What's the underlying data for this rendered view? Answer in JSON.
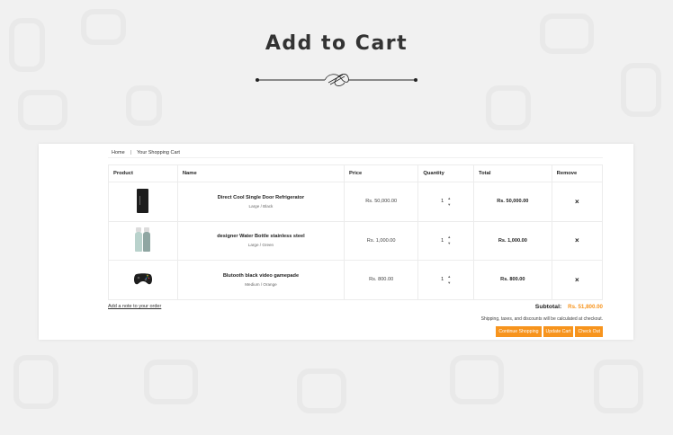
{
  "page": {
    "title": "Add to Cart"
  },
  "breadcrumb": {
    "home": "Home",
    "separator": "|",
    "current": "Your Shopping Cart"
  },
  "table": {
    "headers": [
      "Product",
      "Name",
      "Price",
      "Quantity",
      "Total",
      "Remove"
    ],
    "rows": [
      {
        "thumb_icon": "refrigerator-image",
        "name": "Direct Cool Single Door Refrigerator",
        "variant": "Large / Black",
        "price": "Rs. 50,000.00",
        "quantity": "1",
        "total": "Rs. 50,000.00",
        "remove": "×"
      },
      {
        "thumb_icon": "water-bottle-image",
        "name": "designer Water Bottle stainless steel",
        "variant": "Large / Green",
        "price": "Rs. 1,000.00",
        "quantity": "1",
        "total": "Rs. 1,000.00",
        "remove": "×"
      },
      {
        "thumb_icon": "gamepad-image",
        "name": "Blutooth black video gamepade",
        "variant": "Medium / Orange",
        "price": "Rs. 800.00",
        "quantity": "1",
        "total": "Rs. 800.00",
        "remove": "×"
      }
    ]
  },
  "footer": {
    "note_link": "Add a note to your order",
    "subtotal_label": "Subtotal:",
    "subtotal_value": "Rs. 51,800.00",
    "shipping_note": "Shipping, taxes, and discounts will be calculated at checkout.",
    "buttons": {
      "continue": "Continue Shopping",
      "update": "Update Cart",
      "checkout": "Check Out"
    }
  },
  "colors": {
    "accent": "#f7941d",
    "background": "#f1f1f1"
  }
}
